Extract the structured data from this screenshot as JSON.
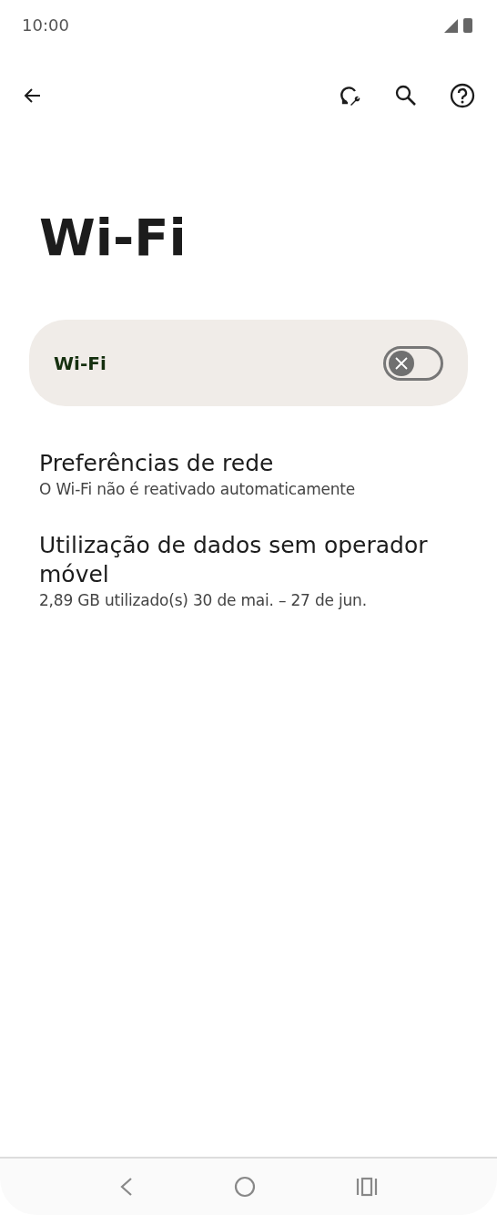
{
  "status_bar": {
    "time": "10:00"
  },
  "title": "Wi-Fi",
  "wifi_toggle": {
    "label": "Wi-Fi",
    "on": false
  },
  "items": [
    {
      "title": "Preferências de rede",
      "subtitle": "O Wi-Fi não é reativado automaticamente"
    },
    {
      "title": "Utilização de dados sem operador móvel",
      "subtitle": "2,89 GB utilizado(s) 30 de mai. – 27 de jun."
    }
  ]
}
